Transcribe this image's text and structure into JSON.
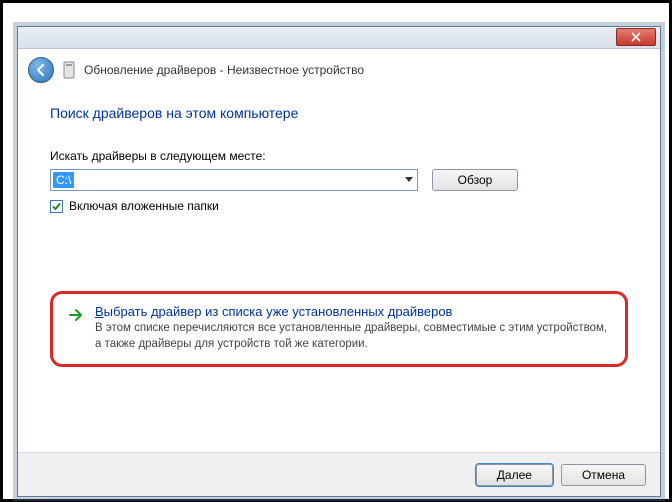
{
  "window": {
    "title": "Обновление драйверов - Неизвестное устройство"
  },
  "page": {
    "title": "Поиск драйверов на этом компьютере",
    "search_label": "Искать драйверы в следующем месте:",
    "path_value": "C:\\",
    "browse_button": "Обзор",
    "include_subfolders": "Включая вложенные папки",
    "include_subfolders_checked": true
  },
  "command_link": {
    "accel": "В",
    "title_rest": "ыбрать драйвер из списка уже установленных драйверов",
    "description": "В этом списке перечисляются все установленные драйверы, совместимые с этим устройством, а также драйверы для устройств той же категории."
  },
  "buttons": {
    "next": "Далее",
    "cancel": "Отмена"
  }
}
